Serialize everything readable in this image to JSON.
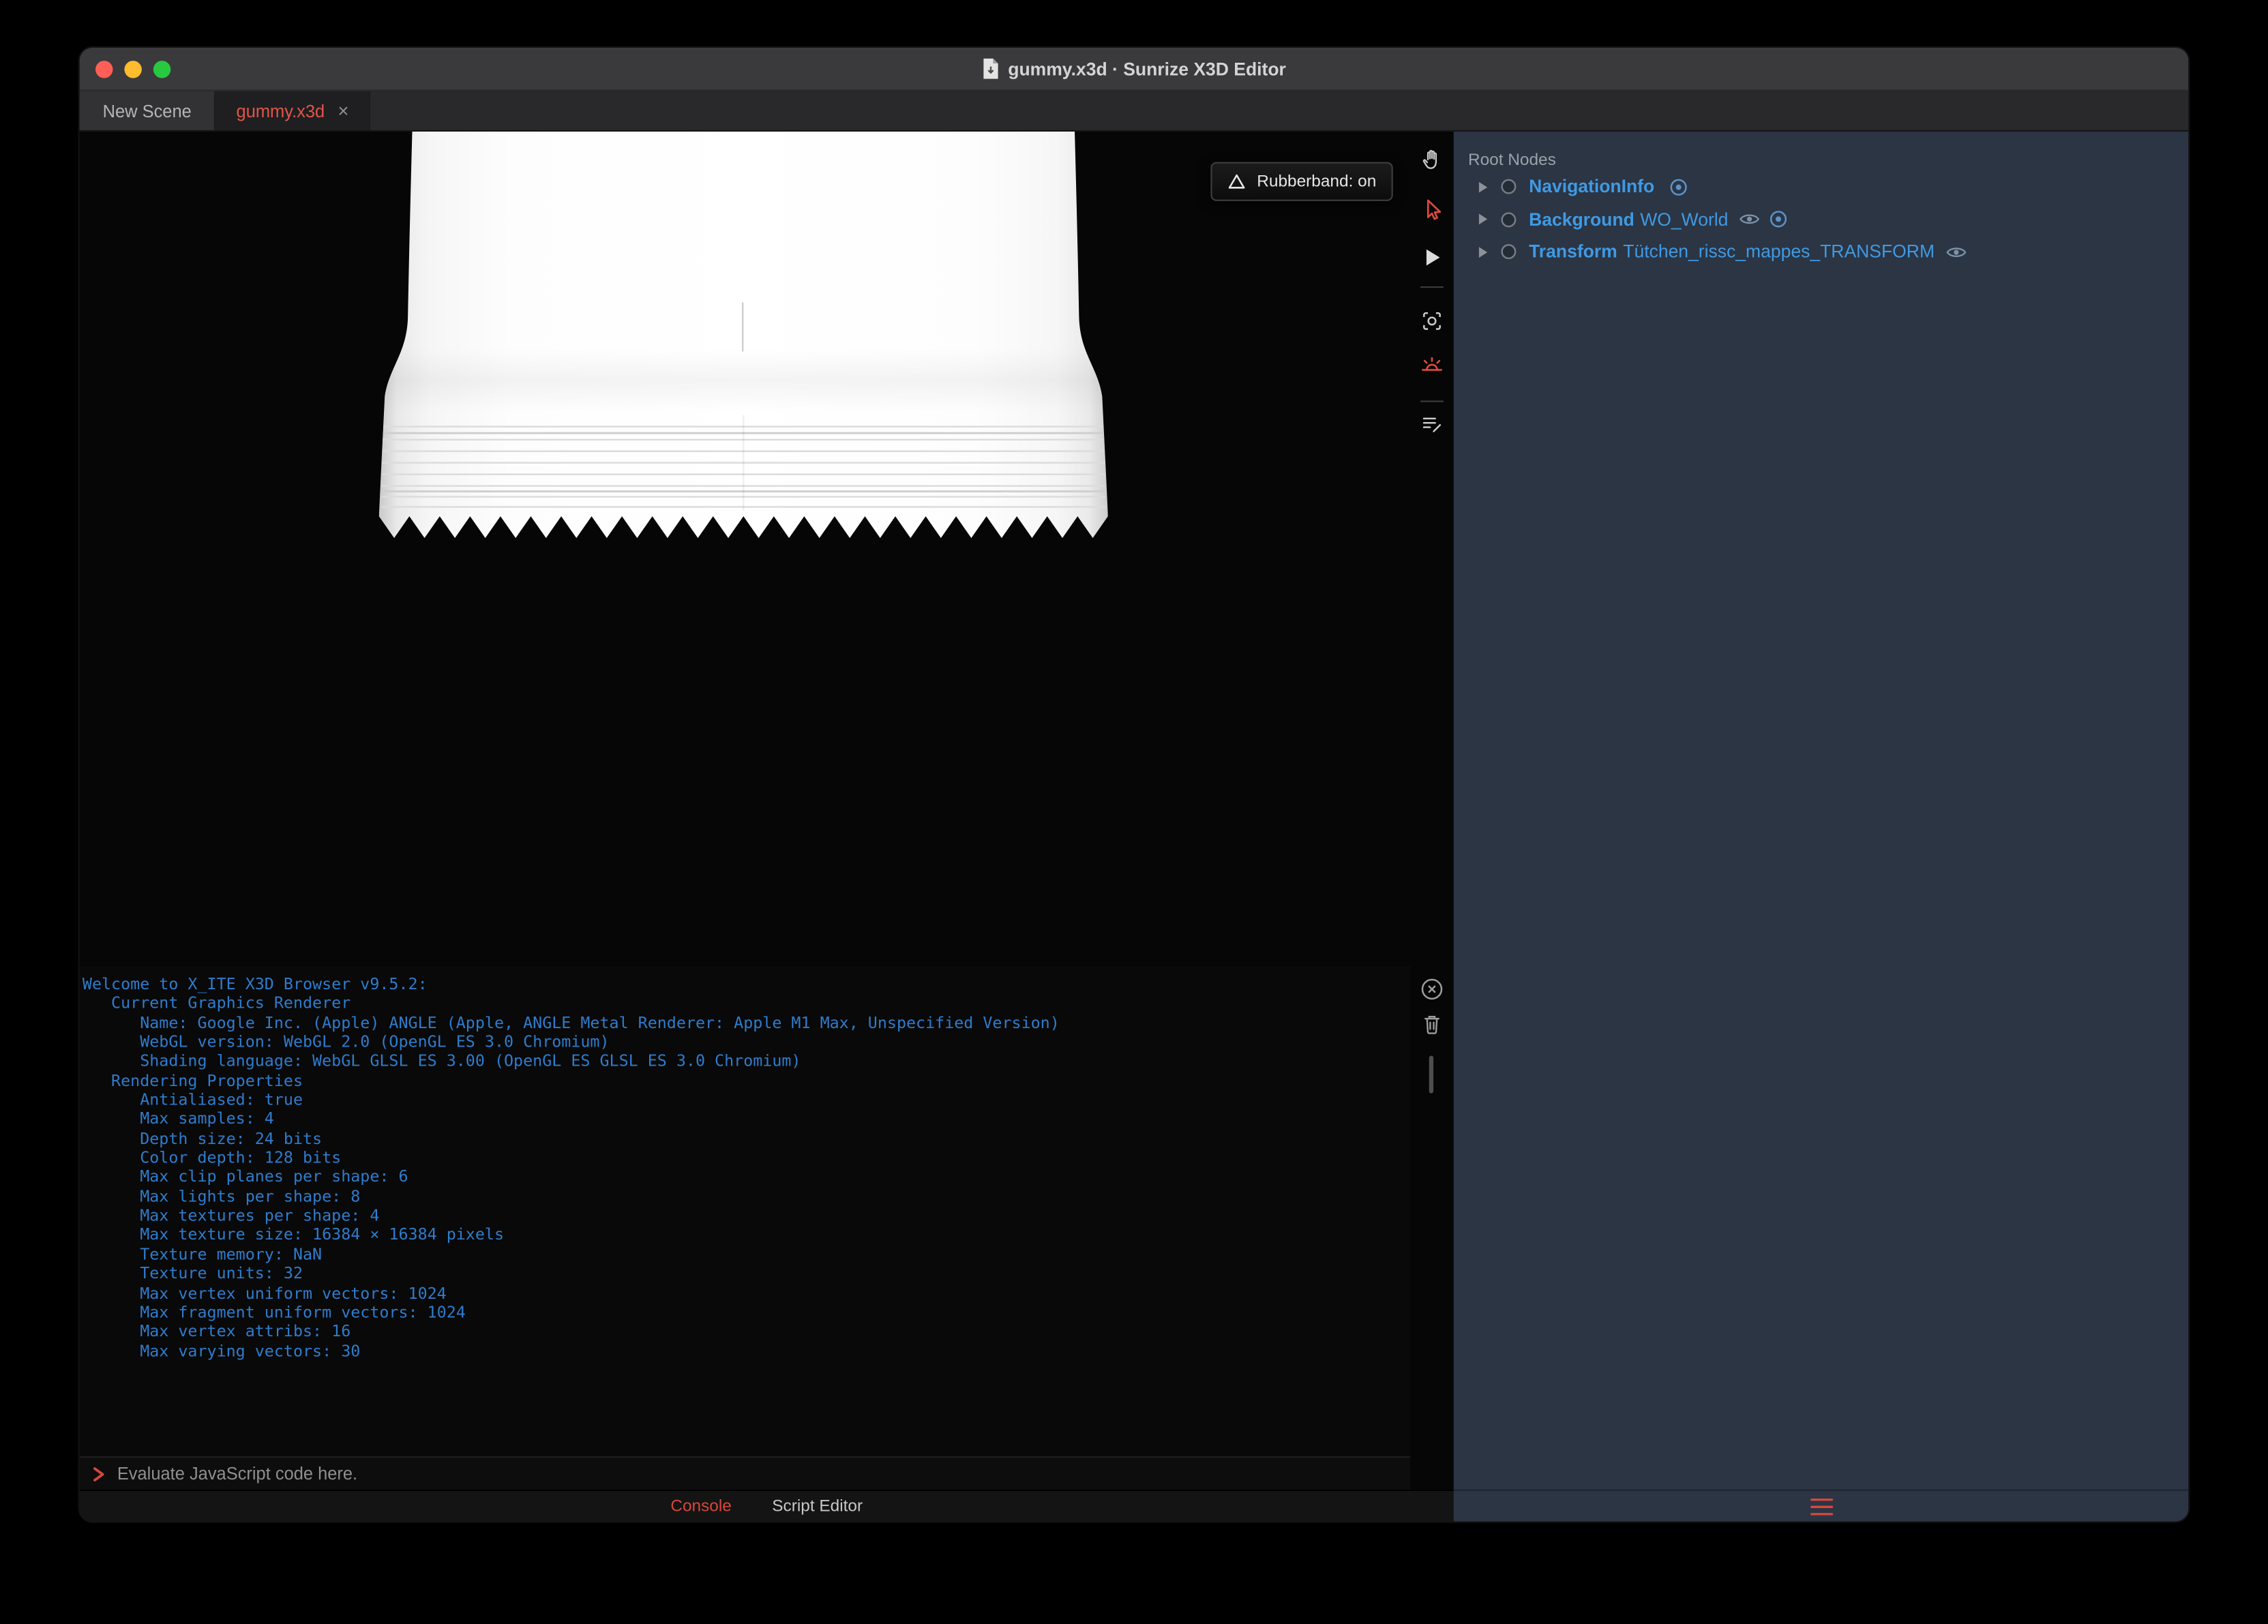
{
  "titlebar": {
    "title": "gummy.x3d · Sunrize X3D Editor"
  },
  "tabs": [
    {
      "label": "New Scene",
      "active": false
    },
    {
      "label": "gummy.x3d",
      "active": true,
      "close": "×"
    }
  ],
  "viewport": {
    "rubberband": "Rubberband: on"
  },
  "toolbar": {
    "icons": [
      "hand-pan",
      "pointer-select",
      "play",
      "viewfinder",
      "sunrise",
      "script-edit",
      "clear-console",
      "trash-console"
    ]
  },
  "outline": {
    "header": "Root Nodes",
    "nodes": [
      {
        "type": "NavigationInfo",
        "name": "",
        "icons": [
          "fisheye"
        ]
      },
      {
        "type": "Background",
        "name": "WO_World",
        "icons": [
          "eye",
          "fisheye"
        ]
      },
      {
        "type": "Transform",
        "name": "Tütchen_rissc_mappes_TRANSFORM",
        "icons": [
          "eye"
        ]
      }
    ]
  },
  "console": {
    "lines": [
      "Welcome to X_ITE X3D Browser v9.5.2:",
      "   Current Graphics Renderer",
      "      Name: Google Inc. (Apple) ANGLE (Apple, ANGLE Metal Renderer: Apple M1 Max, Unspecified Version)",
      "      WebGL version: WebGL 2.0 (OpenGL ES 3.0 Chromium)",
      "      Shading language: WebGL GLSL ES 3.00 (OpenGL ES GLSL ES 3.0 Chromium)",
      "   Rendering Properties",
      "      Antialiased: true",
      "      Max samples: 4",
      "      Depth size: 24 bits",
      "      Color depth: 128 bits",
      "      Max clip planes per shape: 6",
      "      Max lights per shape: 8",
      "      Max textures per shape: 4",
      "      Max texture size: 16384 × 16384 pixels",
      "      Texture memory: NaN",
      "      Texture units: 32",
      "      Max vertex uniform vectors: 1024",
      "      Max fragment uniform vectors: 1024",
      "      Max vertex attribs: 16",
      "      Max varying vectors: 30"
    ],
    "prompt": "❯",
    "placeholder": "Evaluate JavaScript code here.",
    "tabs": [
      {
        "label": "Console",
        "active": true
      },
      {
        "label": "Script Editor",
        "active": false
      }
    ]
  },
  "colors": {
    "accent_red": "#DF4A3F",
    "node_blue": "#3F9AE4",
    "console_blue": "#2E7CCD",
    "panel_bg": "#2B3544",
    "titlebar_bg": "#3A3A3C"
  }
}
